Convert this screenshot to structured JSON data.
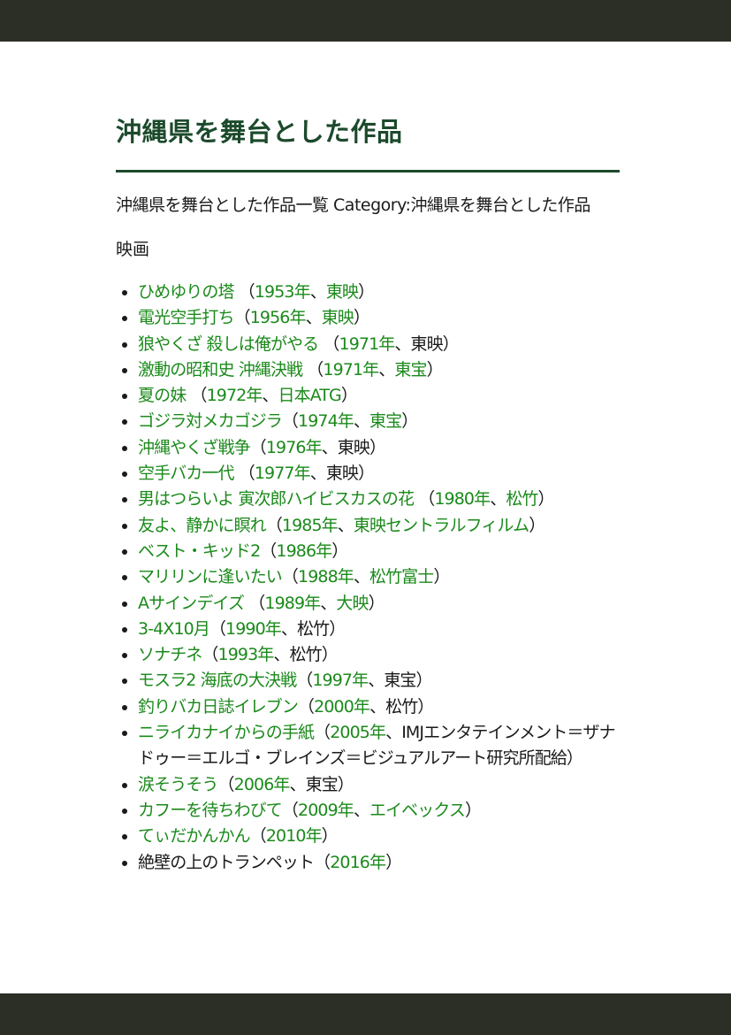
{
  "page": {
    "title": "沖縄県を舞台とした作品",
    "intro": "沖縄県を舞台とした作品一覧 Category:沖縄県を舞台とした作品",
    "section_heading": "映画"
  },
  "colors": {
    "link": "#1b8a1b",
    "text": "#1a1a1a",
    "heading": "#1c4a2c",
    "bars": "#2b2f26"
  },
  "films": [
    {
      "title": "ひめゆりの塔",
      "title_link": true,
      "open": " （",
      "year": "1953年",
      "year_link": true,
      "sep": "、",
      "company": "東映",
      "company_link": true,
      "close": "）"
    },
    {
      "title": "電光空手打ち",
      "title_link": true,
      "open": "（",
      "year": "1956年",
      "year_link": true,
      "sep": "、",
      "company": "東映",
      "company_link": true,
      "close": "）"
    },
    {
      "title": "狼やくざ 殺しは俺がやる",
      "title_link": true,
      "open": " （",
      "year": "1971年",
      "year_link": true,
      "sep": "、",
      "company": "東映",
      "company_link": false,
      "close": "）"
    },
    {
      "title": "激動の昭和史 沖縄決戦",
      "title_link": true,
      "open": " （",
      "year": "1971年",
      "year_link": true,
      "sep": "、",
      "company": "東宝",
      "company_link": true,
      "close": "）"
    },
    {
      "title": "夏の妹",
      "title_link": true,
      "open": " （",
      "year": "1972年",
      "year_link": true,
      "sep": "、",
      "company": "日本ATG",
      "company_link": true,
      "close": "）"
    },
    {
      "title": "ゴジラ対メカゴジラ",
      "title_link": true,
      "open": "（",
      "year": "1974年",
      "year_link": true,
      "sep": "、",
      "company": "東宝",
      "company_link": true,
      "close": "）"
    },
    {
      "title": "沖縄やくざ戦争",
      "title_link": true,
      "open": "（",
      "year": "1976年",
      "year_link": true,
      "sep": "、",
      "company": "東映",
      "company_link": false,
      "close": "）"
    },
    {
      "title": "空手バカ一代",
      "title_link": true,
      "open": " （",
      "year": "1977年",
      "year_link": true,
      "sep": "、",
      "company": "東映",
      "company_link": false,
      "close": "）"
    },
    {
      "title": "男はつらいよ 寅次郎ハイビスカスの花",
      "title_link": true,
      "open": " （",
      "year": "1980年",
      "year_link": true,
      "sep": "、",
      "company": "松竹",
      "company_link": true,
      "close": "）"
    },
    {
      "title": "友よ、静かに瞑れ",
      "title_link": true,
      "open": "（",
      "year": "1985年",
      "year_link": true,
      "sep": "、",
      "company": "東映セントラルフィルム",
      "company_link": true,
      "close": "）"
    },
    {
      "title": "ベスト・キッド2",
      "title_link": true,
      "open": "（",
      "year": "1986年",
      "year_link": true,
      "sep": "",
      "company": "",
      "company_link": false,
      "close": "）"
    },
    {
      "title": "マリリンに逢いたい",
      "title_link": true,
      "open": "（",
      "year": "1988年",
      "year_link": true,
      "sep": "、",
      "company": "松竹富士",
      "company_link": true,
      "close": "）"
    },
    {
      "title": "Aサインデイズ",
      "title_link": true,
      "open": " （",
      "year": "1989年",
      "year_link": true,
      "sep": "、",
      "company": "大映",
      "company_link": true,
      "close": "）"
    },
    {
      "title": "3-4X10月",
      "title_link": true,
      "open": "（",
      "year": "1990年",
      "year_link": true,
      "sep": "、",
      "company": "松竹",
      "company_link": false,
      "close": "）"
    },
    {
      "title": "ソナチネ",
      "title_link": true,
      "open": "（",
      "year": "1993年",
      "year_link": true,
      "sep": "、",
      "company": "松竹",
      "company_link": false,
      "close": "）"
    },
    {
      "title": "モスラ2 海底の大決戦",
      "title_link": true,
      "open": "（",
      "year": "1997年",
      "year_link": true,
      "sep": "、",
      "company": "東宝",
      "company_link": false,
      "close": "）"
    },
    {
      "title": "釣りバカ日誌イレブン",
      "title_link": true,
      "open": "（",
      "year": "2000年",
      "year_link": true,
      "sep": "、",
      "company": "松竹",
      "company_link": false,
      "close": "）"
    },
    {
      "title": "ニライカナイからの手紙",
      "title_link": true,
      "open": "（",
      "year": "2005年",
      "year_link": true,
      "sep": "、",
      "company": "IMJエンタテインメント＝ザナドゥー＝エルゴ・ブレインズ＝ビジュアルアート研究所配給",
      "company_link": false,
      "close": "）"
    },
    {
      "title": "涙そうそう",
      "title_link": true,
      "open": "（",
      "year": "2006年",
      "year_link": true,
      "sep": "、",
      "company": "東宝",
      "company_link": false,
      "close": "）"
    },
    {
      "title": "カフーを待ちわびて",
      "title_link": true,
      "open": "（",
      "year": "2009年",
      "year_link": true,
      "sep": "、",
      "company": "エイベックス",
      "company_link": true,
      "close": "）"
    },
    {
      "title": "てぃだかんかん",
      "title_link": true,
      "open": "（",
      "year": "2010年",
      "year_link": true,
      "sep": "",
      "company": "",
      "company_link": false,
      "close": "）"
    },
    {
      "title": "絶壁の上のトランペット",
      "title_link": false,
      "open": "（",
      "year": "2016年",
      "year_link": true,
      "sep": "",
      "company": "",
      "company_link": false,
      "close": "）"
    }
  ]
}
